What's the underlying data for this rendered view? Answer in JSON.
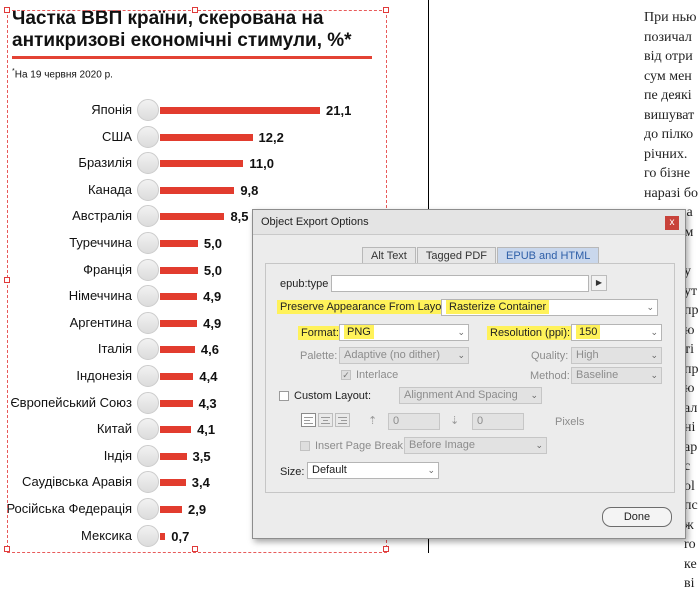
{
  "chart_data": {
    "type": "bar",
    "title": "Частка ВВП країни, скерована на антикризові економічні стимули, %*",
    "note": "На 19 червня 2020 р.",
    "categories": [
      "Японія",
      "США",
      "Бразилія",
      "Канада",
      "Австралія",
      "Туреччина",
      "Франція",
      "Німеччина",
      "Аргентина",
      "Італія",
      "Індонезія",
      "Європейський Союз",
      "Китай",
      "Індія",
      "Саудівська Аравія",
      "Російська Федерація",
      "Мексика"
    ],
    "values": [
      21.1,
      12.2,
      11.0,
      9.8,
      8.5,
      5.0,
      5.0,
      4.9,
      4.9,
      4.6,
      4.4,
      4.3,
      4.1,
      3.5,
      3.4,
      2.9,
      0.7
    ],
    "value_labels": [
      "21,1",
      "12,2",
      "11,0",
      "9,8",
      "8,5",
      "5,0",
      "5,0",
      "4,9",
      "4,9",
      "4,6",
      "4,4",
      "4,3",
      "4,1",
      "3,5",
      "3,4",
      "2,9",
      "0,7"
    ],
    "bar_color": "#e23c2e",
    "xlim": [
      0,
      21.1
    ]
  },
  "body_text_lines": [
    "При нью",
    "позичал",
    "від отри",
    "сум мен",
    "пе деякі",
    "вишуват",
    "до пілко",
    "річних. ",
    "го бізне",
    "наразі бо",
    "сотки за",
    "програм",
    "ак",
    "т К",
    "в"
  ],
  "body_text_lines2": [
    "у",
    "ут",
    "пр",
    "ю",
    "ті",
    "пр",
    "ю",
    "ал",
    "ні",
    "ар",
    "с",
    "ol",
    "пс",
    "ж",
    "ro",
    "ке",
    "ві"
  ],
  "dialog": {
    "title": "Object Export Options",
    "close_label": "x",
    "tabs": [
      "Alt Text",
      "Tagged PDF",
      "EPUB and HTML"
    ],
    "active_tab": "EPUB and HTML",
    "epub_type_label": "epub:type",
    "epub_type_value": "",
    "preserve_label": "Preserve Appearance From Layout:",
    "preserve_value": "Rasterize Container",
    "format_label": "Format:",
    "format_value": "PNG",
    "resolution_label": "Resolution (ppi):",
    "resolution_value": "150",
    "palette_label": "Palette:",
    "palette_value": "Adaptive (no dither)",
    "quality_label": "Quality:",
    "quality_value": "High",
    "interlace_label": "Interlace",
    "method_label": "Method:",
    "method_value": "Baseline",
    "custom_layout_label": "Custom Layout:",
    "custom_layout_value": "Alignment And Spacing",
    "spacing_before_value": "0",
    "spacing_after_value": "0",
    "pixels_label": "Pixels",
    "page_break_label": "Insert Page Break:",
    "page_break_value": "Before Image",
    "size_label": "Size:",
    "size_value": "Default",
    "done_label": "Done",
    "highlight_color": "#fff25a"
  }
}
